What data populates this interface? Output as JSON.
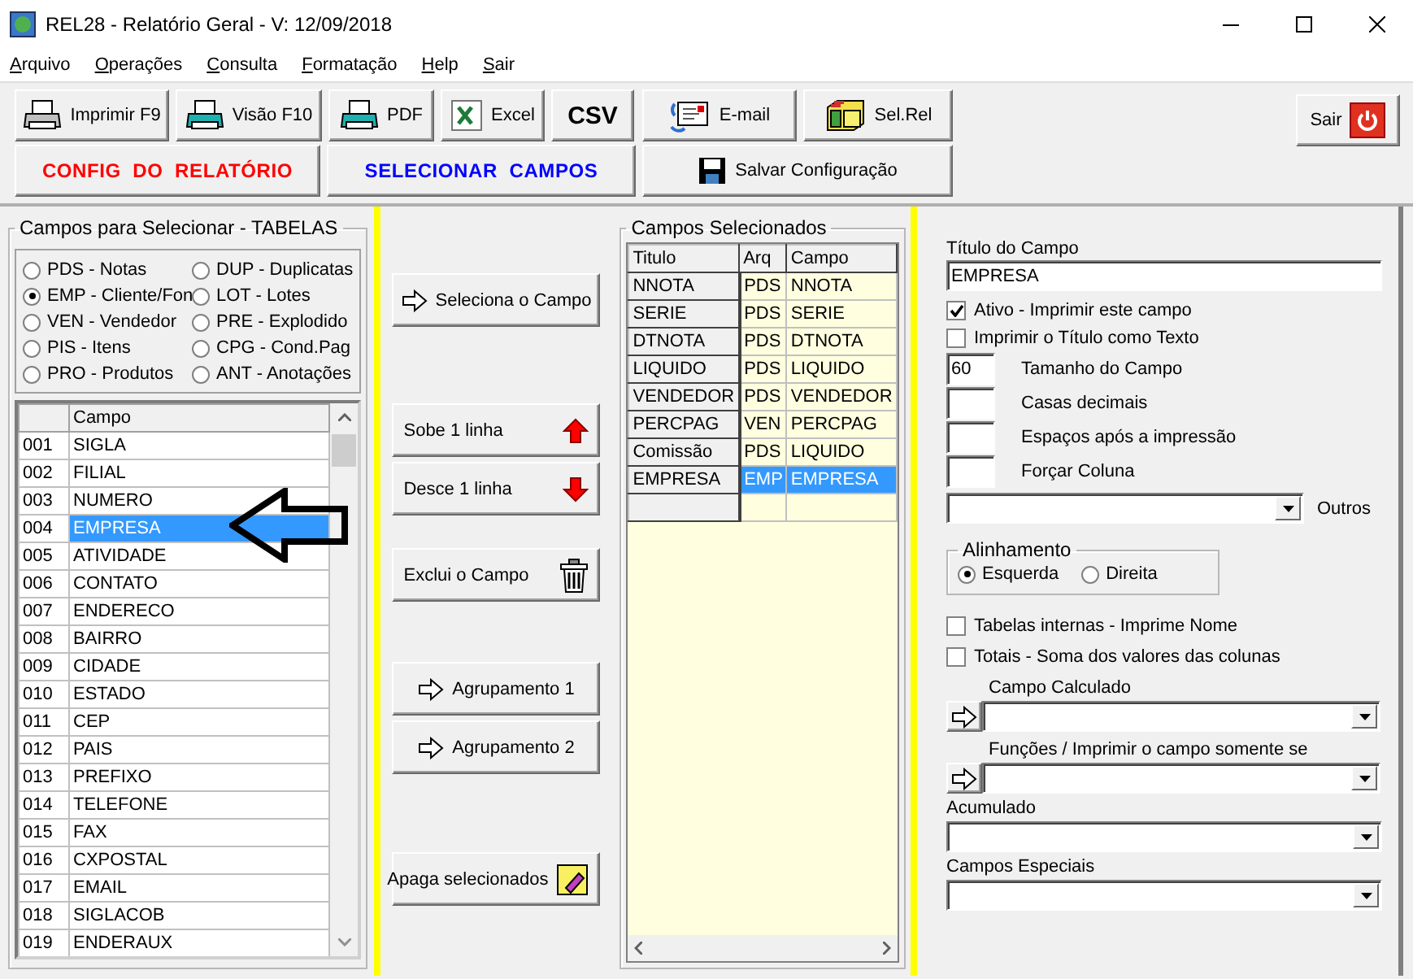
{
  "window": {
    "title": "REL28 - Relatório Geral - V: 12/09/2018"
  },
  "menu": [
    {
      "label": "Arquivo"
    },
    {
      "label": "Operações"
    },
    {
      "label": "Consulta"
    },
    {
      "label": "Formatação"
    },
    {
      "label": "Help"
    },
    {
      "label": "Sair"
    }
  ],
  "toolbar": [
    {
      "label": "Imprimir F9",
      "kind": "print"
    },
    {
      "label": "Visão F10",
      "kind": "preview"
    },
    {
      "label": "PDF",
      "kind": "preview"
    },
    {
      "label": "Excel",
      "kind": "excel"
    },
    {
      "label": "CSV",
      "kind": "text"
    },
    {
      "label": "E-mail",
      "kind": "email"
    },
    {
      "label": "Sel.Rel",
      "kind": "files"
    }
  ],
  "toolbar_row_2": [
    {
      "label": "CONFIG  DO  RELATÓRIO",
      "kind": "text",
      "color": "#ff0000"
    },
    {
      "label": "SELECIONAR  CAMPOS",
      "kind": "text",
      "color": "#0000ff"
    },
    {
      "label": "Salvar Configuração",
      "kind": "save",
      "color": "#000000"
    }
  ],
  "exit_button": {
    "label": "Sair"
  },
  "tables_group": {
    "title": "Campos para Selecionar  - TABELAS",
    "options": [
      {
        "label": "PDS - Notas",
        "selected": false
      },
      {
        "label": "DUP - Duplicatas",
        "selected": false
      },
      {
        "label": "EMP - Cliente/Fon",
        "selected": true
      },
      {
        "label": "LOT - Lotes",
        "selected": false
      },
      {
        "label": "VEN - Vendedor",
        "selected": false
      },
      {
        "label": "PRE - Explodido",
        "selected": false
      },
      {
        "label": "PIS - Itens",
        "selected": false
      },
      {
        "label": "CPG - Cond.Pag",
        "selected": false
      },
      {
        "label": "PRO - Produtos",
        "selected": false
      },
      {
        "label": "ANT - Anotações",
        "selected": false
      }
    ]
  },
  "fields_list": {
    "column": "Campo",
    "rows": [
      {
        "number": "001",
        "name": "SIGLA",
        "selected": false
      },
      {
        "number": "002",
        "name": "FILIAL",
        "selected": false
      },
      {
        "number": "003",
        "name": "NUMERO",
        "selected": false
      },
      {
        "number": "004",
        "name": "EMPRESA",
        "selected": true
      },
      {
        "number": "005",
        "name": "ATIVIDADE",
        "selected": false
      },
      {
        "number": "006",
        "name": "CONTATO",
        "selected": false
      },
      {
        "number": "007",
        "name": "ENDERECO",
        "selected": false
      },
      {
        "number": "008",
        "name": "BAIRRO",
        "selected": false
      },
      {
        "number": "009",
        "name": "CIDADE",
        "selected": false
      },
      {
        "number": "010",
        "name": "ESTADO",
        "selected": false
      },
      {
        "number": "011",
        "name": "CEP",
        "selected": false
      },
      {
        "number": "012",
        "name": "PAIS",
        "selected": false
      },
      {
        "number": "013",
        "name": "PREFIXO",
        "selected": false
      },
      {
        "number": "014",
        "name": "TELEFONE",
        "selected": false
      },
      {
        "number": "015",
        "name": "FAX",
        "selected": false
      },
      {
        "number": "016",
        "name": "CXPOSTAL",
        "selected": false
      },
      {
        "number": "017",
        "name": "EMAIL",
        "selected": false
      },
      {
        "number": "018",
        "name": "SIGLACOB",
        "selected": false
      },
      {
        "number": "019",
        "name": "ENDERAUX",
        "selected": false
      }
    ]
  },
  "actions": [
    {
      "label": "Seleciona o Campo",
      "kind": "select"
    },
    {
      "label": "Sobe 1 linha",
      "kind": "up"
    },
    {
      "label": "Desce 1 linha",
      "kind": "down"
    },
    {
      "label": "Exclui o Campo",
      "kind": "delete"
    },
    {
      "label": "Agrupamento 1",
      "kind": "select"
    },
    {
      "label": "Agrupamento 2",
      "kind": "select"
    },
    {
      "label": "Apaga selecionados",
      "kind": "erase"
    }
  ],
  "selected_group": {
    "title": "Campos Selecionados",
    "columns": [
      "Titulo",
      "Arq",
      "Campo"
    ],
    "rows": [
      {
        "title": "NNOTA",
        "file": "PDS",
        "field": "NNOTA",
        "selected": false
      },
      {
        "title": "SERIE",
        "file": "PDS",
        "field": "SERIE",
        "selected": false
      },
      {
        "title": "DTNOTA",
        "file": "PDS",
        "field": "DTNOTA",
        "selected": false
      },
      {
        "title": "LIQUIDO",
        "file": "PDS",
        "field": "LIQUIDO",
        "selected": false
      },
      {
        "title": "VENDEDOR",
        "file": "PDS",
        "field": "VENDEDOR",
        "selected": false
      },
      {
        "title": "PERCPAG",
        "file": "VEN",
        "field": "PERCPAG",
        "selected": false
      },
      {
        "title": "Comissão",
        "file": "PDS",
        "field": "LIQUIDO",
        "selected": false
      },
      {
        "title": "EMPRESA",
        "file": "EMP",
        "field": "EMPRESA",
        "selected": true
      }
    ]
  },
  "properties": {
    "title_label": "Título do Campo",
    "title_value": "EMPRESA",
    "checks_top": [
      {
        "label": "Ativo - Imprimir este campo",
        "checked": true
      },
      {
        "label": "Imprimir o Título como Texto",
        "checked": false
      }
    ],
    "numbers": [
      {
        "label": "Tamanho do Campo",
        "value": "60"
      },
      {
        "label": "Casas decimais"
      },
      {
        "label": "Espaços após a impressão"
      },
      {
        "label": "Forçar Coluna"
      }
    ],
    "other_label": "Outros",
    "alignment": {
      "title": "Alinhamento",
      "options": [
        {
          "label": "Esquerda",
          "selected": true
        },
        {
          "label": "Direita",
          "selected": false
        }
      ]
    },
    "checks_bottom": [
      {
        "label": "Tabelas internas - Imprime Nome",
        "checked": false
      },
      {
        "label": "Totais - Soma dos valores das colunas",
        "checked": false
      }
    ],
    "combos": [
      {
        "label": "Campo Calculado",
        "kind": "arrow"
      },
      {
        "label": "Funções / Imprimir o campo somente se",
        "kind": "arrow"
      },
      {
        "label": "Acumulado",
        "kind": "plain"
      },
      {
        "label": "Campos Especiais",
        "kind": "plain"
      }
    ]
  }
}
